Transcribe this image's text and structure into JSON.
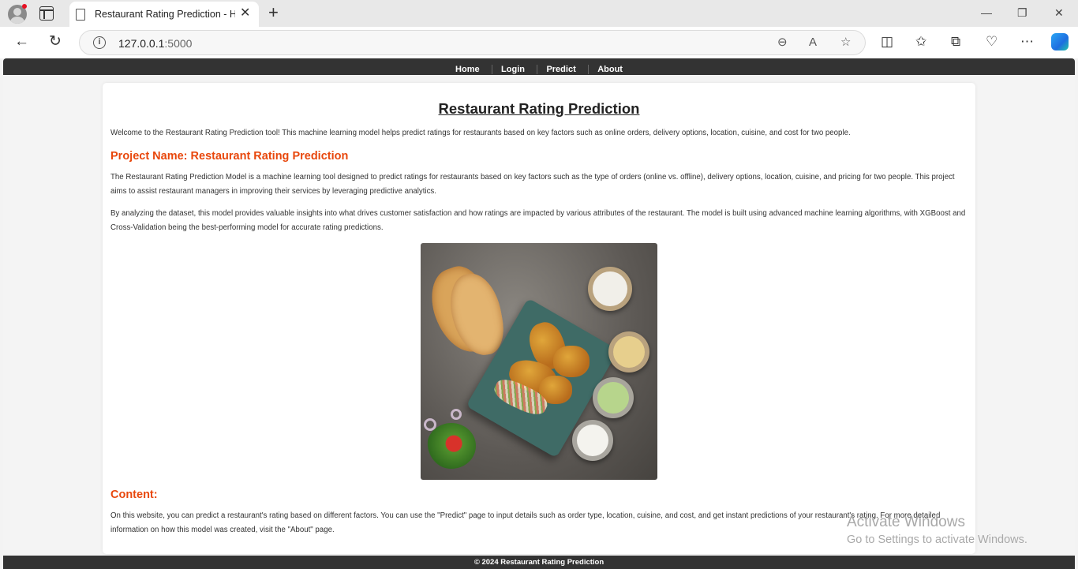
{
  "browser": {
    "tab_title": "Restaurant Rating Prediction - Ho",
    "tab_close": "✕",
    "new_tab": "+",
    "window_controls": {
      "minimize": "—",
      "restore": "❐",
      "close": "✕"
    },
    "nav": {
      "back": "←",
      "reload": "↻"
    },
    "url_host": "127.0.0.1",
    "url_port": ":5000",
    "omnibox_icons": [
      "zoom-out-icon",
      "read-aloud-icon",
      "favorite-star-icon"
    ],
    "toolbar_icons": [
      "split-screen-icon",
      "favorites-icon",
      "collections-icon",
      "browser-essentials-icon",
      "more-icon",
      "copilot-icon"
    ]
  },
  "site": {
    "nav": [
      "Home",
      "Login",
      "Predict",
      "About"
    ],
    "title": "Restaurant Rating Prediction",
    "intro": "Welcome to the Restaurant Rating Prediction tool! This machine learning model helps predict ratings for restaurants based on key factors such as online orders, delivery options, location, cuisine, and cost for two people.",
    "project_heading": "Project Name: Restaurant Rating Prediction",
    "project_p1": "The Restaurant Rating Prediction Model is a machine learning tool designed to predict ratings for restaurants based on key factors such as the type of orders (online vs. offline), delivery options, location, cuisine, and pricing for two people. This project aims to assist restaurant managers in improving their services by leveraging predictive analytics.",
    "project_p2": "By analyzing the dataset, this model provides valuable insights into what drives customer satisfaction and how ratings are impacted by various attributes of the restaurant. The model is built using advanced machine learning algorithms, with XGBoost and Cross-Validation being the best-performing model for accurate rating predictions.",
    "content_heading": "Content:",
    "content_p": "On this website, you can predict a restaurant's rating based on different factors. You can use the \"Predict\" page to input details such as order type, location, cuisine, and cost, and get instant predictions of your restaurant's rating. For more detailed information on how this model was created, visit the \"About\" page.",
    "footer": "© 2024 Restaurant Rating Prediction",
    "accent_color": "#e8470c",
    "nav_bg": "#333333"
  },
  "os_watermark": {
    "line1": "Activate Windows",
    "line2": "Go to Settings to activate Windows."
  }
}
